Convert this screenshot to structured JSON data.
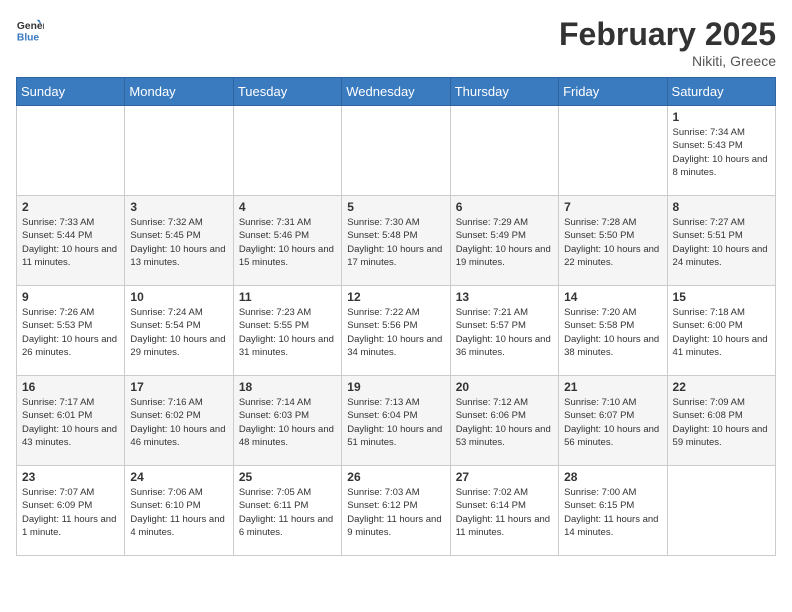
{
  "header": {
    "logo_line1": "General",
    "logo_line2": "Blue",
    "month": "February 2025",
    "location": "Nikiti, Greece"
  },
  "days_of_week": [
    "Sunday",
    "Monday",
    "Tuesday",
    "Wednesday",
    "Thursday",
    "Friday",
    "Saturday"
  ],
  "weeks": [
    [
      {
        "day": "",
        "info": ""
      },
      {
        "day": "",
        "info": ""
      },
      {
        "day": "",
        "info": ""
      },
      {
        "day": "",
        "info": ""
      },
      {
        "day": "",
        "info": ""
      },
      {
        "day": "",
        "info": ""
      },
      {
        "day": "1",
        "info": "Sunrise: 7:34 AM\nSunset: 5:43 PM\nDaylight: 10 hours and 8 minutes."
      }
    ],
    [
      {
        "day": "2",
        "info": "Sunrise: 7:33 AM\nSunset: 5:44 PM\nDaylight: 10 hours and 11 minutes."
      },
      {
        "day": "3",
        "info": "Sunrise: 7:32 AM\nSunset: 5:45 PM\nDaylight: 10 hours and 13 minutes."
      },
      {
        "day": "4",
        "info": "Sunrise: 7:31 AM\nSunset: 5:46 PM\nDaylight: 10 hours and 15 minutes."
      },
      {
        "day": "5",
        "info": "Sunrise: 7:30 AM\nSunset: 5:48 PM\nDaylight: 10 hours and 17 minutes."
      },
      {
        "day": "6",
        "info": "Sunrise: 7:29 AM\nSunset: 5:49 PM\nDaylight: 10 hours and 19 minutes."
      },
      {
        "day": "7",
        "info": "Sunrise: 7:28 AM\nSunset: 5:50 PM\nDaylight: 10 hours and 22 minutes."
      },
      {
        "day": "8",
        "info": "Sunrise: 7:27 AM\nSunset: 5:51 PM\nDaylight: 10 hours and 24 minutes."
      }
    ],
    [
      {
        "day": "9",
        "info": "Sunrise: 7:26 AM\nSunset: 5:53 PM\nDaylight: 10 hours and 26 minutes."
      },
      {
        "day": "10",
        "info": "Sunrise: 7:24 AM\nSunset: 5:54 PM\nDaylight: 10 hours and 29 minutes."
      },
      {
        "day": "11",
        "info": "Sunrise: 7:23 AM\nSunset: 5:55 PM\nDaylight: 10 hours and 31 minutes."
      },
      {
        "day": "12",
        "info": "Sunrise: 7:22 AM\nSunset: 5:56 PM\nDaylight: 10 hours and 34 minutes."
      },
      {
        "day": "13",
        "info": "Sunrise: 7:21 AM\nSunset: 5:57 PM\nDaylight: 10 hours and 36 minutes."
      },
      {
        "day": "14",
        "info": "Sunrise: 7:20 AM\nSunset: 5:58 PM\nDaylight: 10 hours and 38 minutes."
      },
      {
        "day": "15",
        "info": "Sunrise: 7:18 AM\nSunset: 6:00 PM\nDaylight: 10 hours and 41 minutes."
      }
    ],
    [
      {
        "day": "16",
        "info": "Sunrise: 7:17 AM\nSunset: 6:01 PM\nDaylight: 10 hours and 43 minutes."
      },
      {
        "day": "17",
        "info": "Sunrise: 7:16 AM\nSunset: 6:02 PM\nDaylight: 10 hours and 46 minutes."
      },
      {
        "day": "18",
        "info": "Sunrise: 7:14 AM\nSunset: 6:03 PM\nDaylight: 10 hours and 48 minutes."
      },
      {
        "day": "19",
        "info": "Sunrise: 7:13 AM\nSunset: 6:04 PM\nDaylight: 10 hours and 51 minutes."
      },
      {
        "day": "20",
        "info": "Sunrise: 7:12 AM\nSunset: 6:06 PM\nDaylight: 10 hours and 53 minutes."
      },
      {
        "day": "21",
        "info": "Sunrise: 7:10 AM\nSunset: 6:07 PM\nDaylight: 10 hours and 56 minutes."
      },
      {
        "day": "22",
        "info": "Sunrise: 7:09 AM\nSunset: 6:08 PM\nDaylight: 10 hours and 59 minutes."
      }
    ],
    [
      {
        "day": "23",
        "info": "Sunrise: 7:07 AM\nSunset: 6:09 PM\nDaylight: 11 hours and 1 minute."
      },
      {
        "day": "24",
        "info": "Sunrise: 7:06 AM\nSunset: 6:10 PM\nDaylight: 11 hours and 4 minutes."
      },
      {
        "day": "25",
        "info": "Sunrise: 7:05 AM\nSunset: 6:11 PM\nDaylight: 11 hours and 6 minutes."
      },
      {
        "day": "26",
        "info": "Sunrise: 7:03 AM\nSunset: 6:12 PM\nDaylight: 11 hours and 9 minutes."
      },
      {
        "day": "27",
        "info": "Sunrise: 7:02 AM\nSunset: 6:14 PM\nDaylight: 11 hours and 11 minutes."
      },
      {
        "day": "28",
        "info": "Sunrise: 7:00 AM\nSunset: 6:15 PM\nDaylight: 11 hours and 14 minutes."
      },
      {
        "day": "",
        "info": ""
      }
    ]
  ]
}
